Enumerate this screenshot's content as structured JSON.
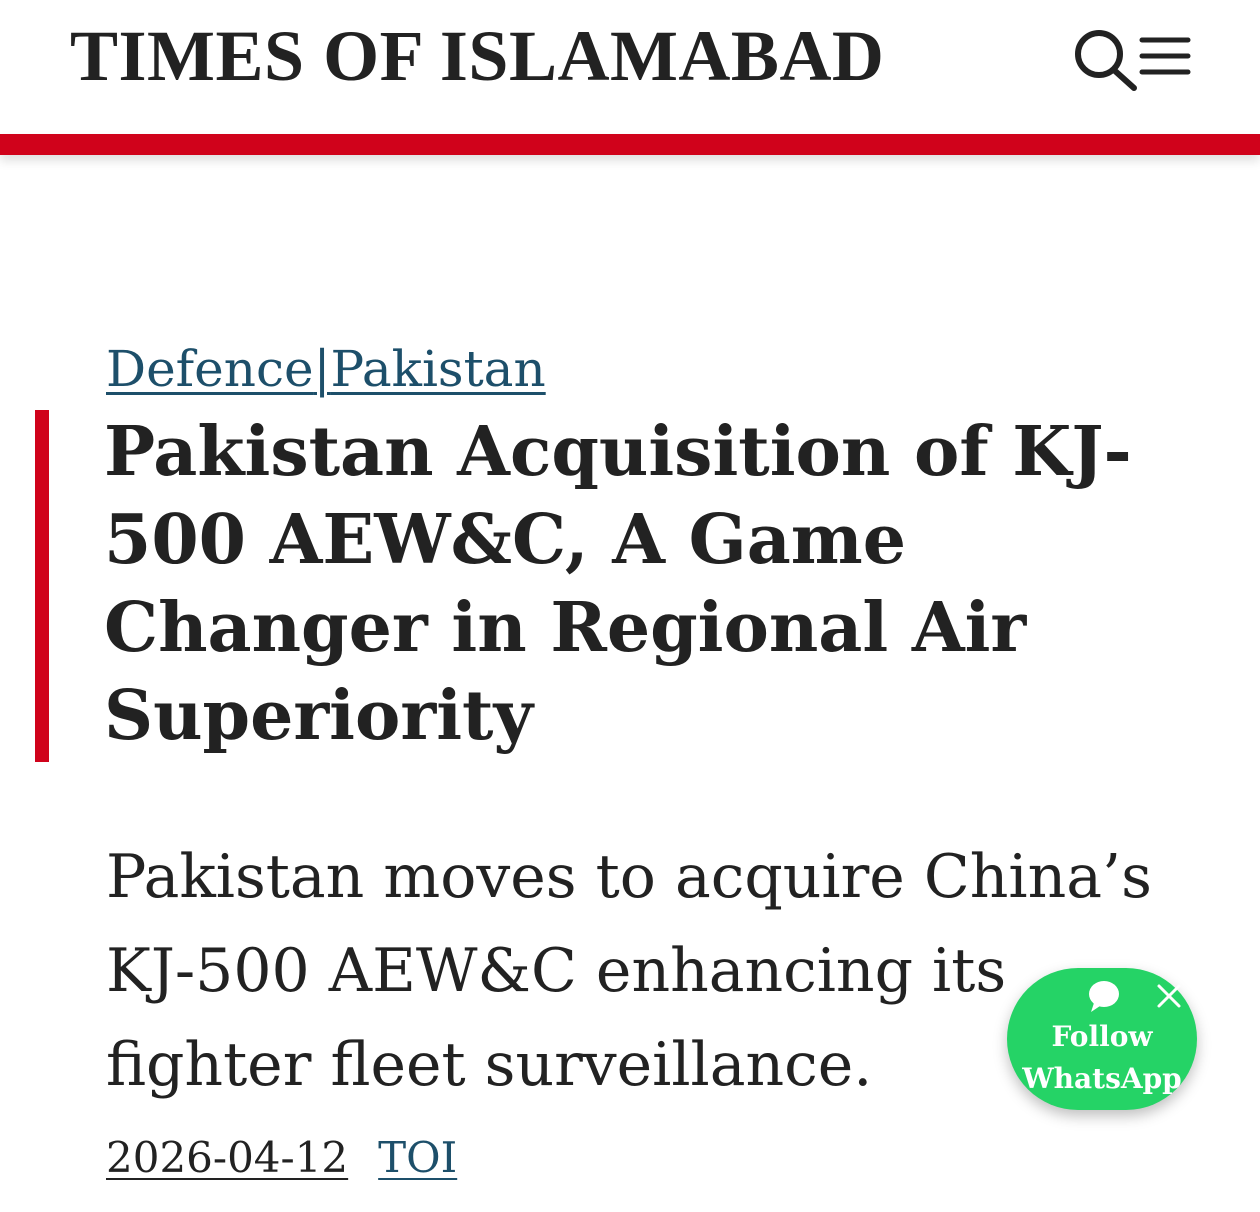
{
  "header": {
    "site_name": "TIMES OF ISLAMABAD",
    "icons": [
      "search-icon",
      "menu-icon"
    ],
    "accent_color": "#d0021b"
  },
  "article": {
    "categories": [
      {
        "label": "Defence"
      },
      {
        "label": "Pakistan"
      }
    ],
    "category_separator": "|",
    "title": "Pakistan Acquisition of KJ-500 AEW&C, A Game Changer in Regional Air Superiority",
    "summary": "Pakistan moves to acquire China’s KJ-500 AEW&C enhancing its fighter fleet surveillance.",
    "date": "2026-04-12",
    "author": "TOI"
  },
  "whatsapp_widget": {
    "line1": "Follow",
    "line2": "WhatsApp",
    "icons": [
      "chat-bubble-icon",
      "close-icon"
    ],
    "color": "#25d366"
  }
}
